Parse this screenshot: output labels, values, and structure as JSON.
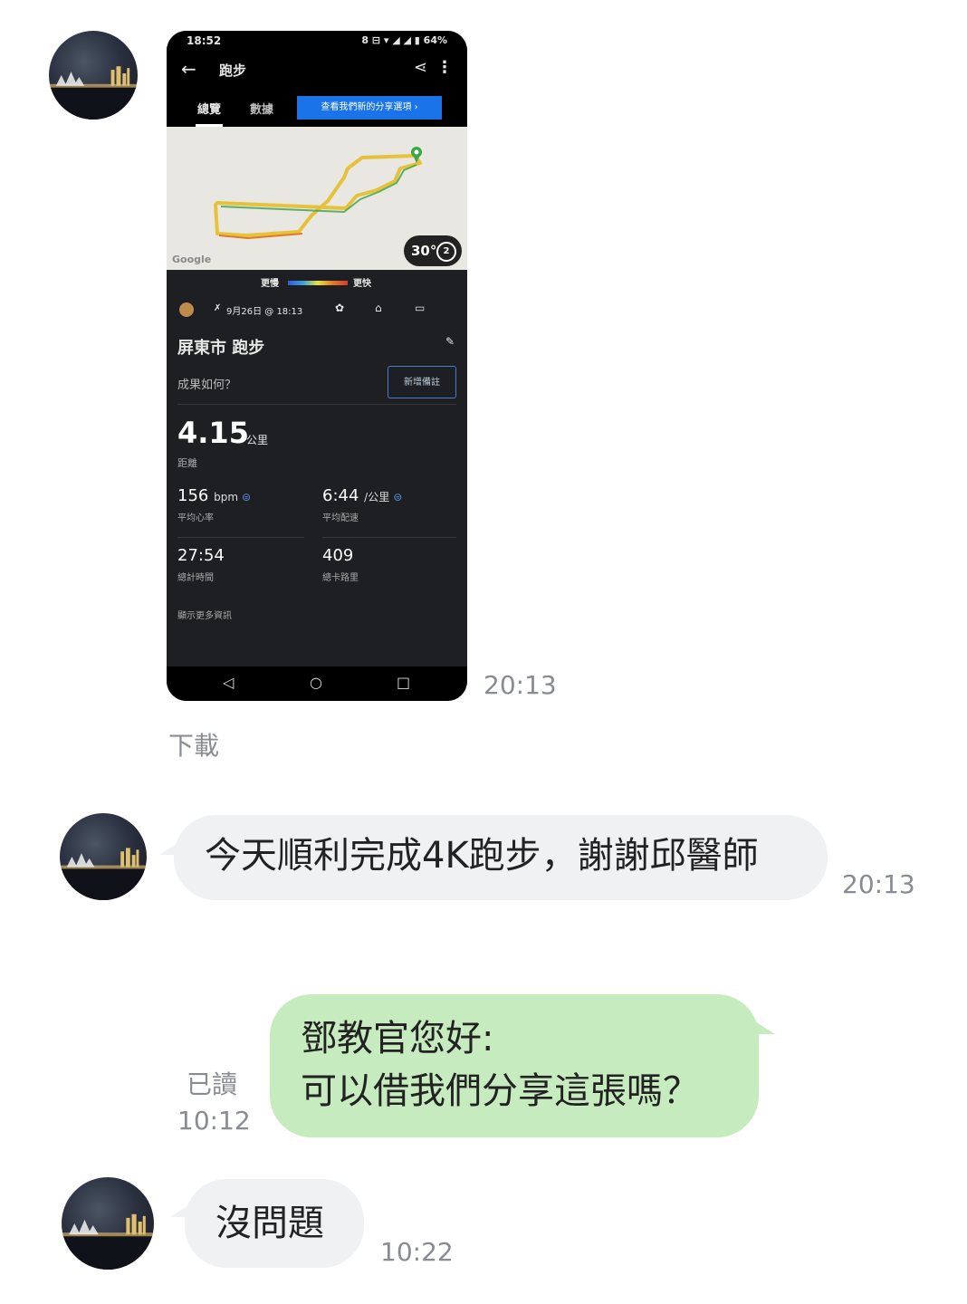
{
  "messages": {
    "m1": {
      "time": "20:13",
      "download_label": "下載"
    },
    "m2": {
      "text": "今天順利完成4K跑步，謝謝邱醫師",
      "time": "20:13"
    },
    "m3": {
      "line1": "鄧教官您好:",
      "line2": "可以借我們分享這張嗎？",
      "read_label": "已讀",
      "time": "10:12"
    },
    "m4": {
      "text": "沒問題",
      "time": "10:22"
    }
  },
  "shared_screenshot": {
    "status_time": "18:52",
    "status_icons": "8 ⊟ ▾ ◢ ◢ ▮ 64%",
    "title": "跑步",
    "tabs": [
      "總覽",
      "數據"
    ],
    "promo_button": "查看我們新的分享選項 ›",
    "map_logo": "Google",
    "map_badge": "30°",
    "map_badge_icon": "2",
    "legend_slow": "更慢",
    "legend_fast": "更快",
    "date": "9月26日 @ 18:13",
    "activity_name": "屏東市 跑步",
    "feel_question": "成果如何？",
    "feel_button": "新增備註",
    "distance_value": "4.15",
    "distance_unit": "公里",
    "distance_label": "距離",
    "stats": [
      {
        "value": "156",
        "unit": "bpm",
        "label": "平均心率"
      },
      {
        "value": "6:44",
        "unit": "/公里",
        "label": "平均配速"
      },
      {
        "value": "27:54",
        "unit": "",
        "label": "總計時間"
      },
      {
        "value": "409",
        "unit": "",
        "label": "總卡路里"
      }
    ],
    "more_label": "顯示更多資訊",
    "nav": [
      "◁",
      "○",
      "□"
    ]
  },
  "colors": {
    "incoming_bubble": "#f0f1f3",
    "outgoing_bubble": "#c6ebbe",
    "meta_text": "#888c92"
  }
}
